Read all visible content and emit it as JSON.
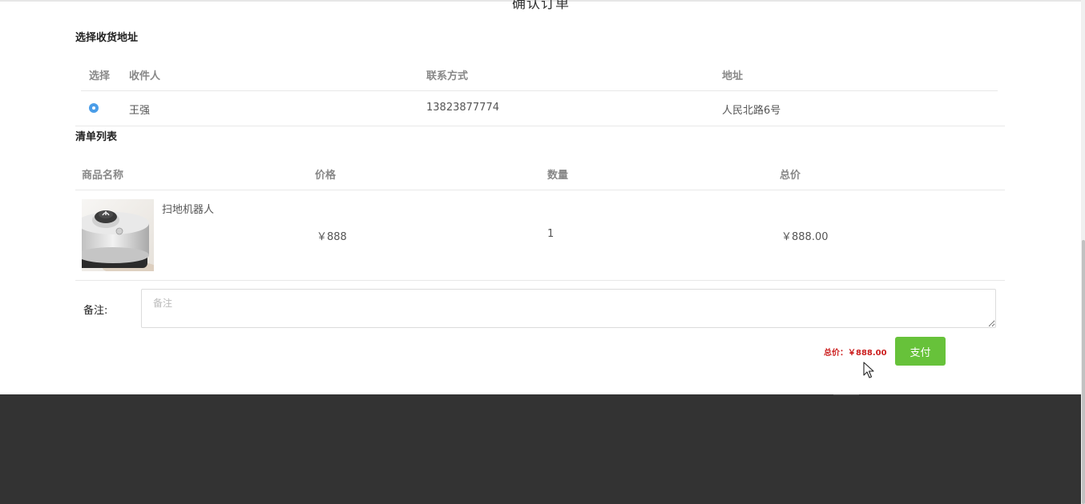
{
  "page_title": "确认订单",
  "address_section": {
    "title": "选择收货地址",
    "headers": {
      "select": "选择",
      "recipient": "收件人",
      "contact": "联系方式",
      "address": "地址"
    },
    "rows": [
      {
        "selected": true,
        "recipient": "王强",
        "contact": "13823877774",
        "address": "人民北路6号"
      }
    ]
  },
  "list_section": {
    "title": "清单列表",
    "headers": {
      "name": "商品名称",
      "price": "价格",
      "quantity": "数量",
      "total": "总价"
    },
    "items": [
      {
        "name": "扫地机器人",
        "price": "￥888",
        "quantity": "1",
        "total": "￥888.00"
      }
    ]
  },
  "remark": {
    "label": "备注:",
    "placeholder": "备注",
    "value": ""
  },
  "summary": {
    "total_text": "总价：￥888.00",
    "pay_label": "支付"
  },
  "colors": {
    "accent_blue": "#4a9de8",
    "pay_green": "#67c23a",
    "total_red": "#cc1f1f",
    "footer_dark": "#333333"
  }
}
